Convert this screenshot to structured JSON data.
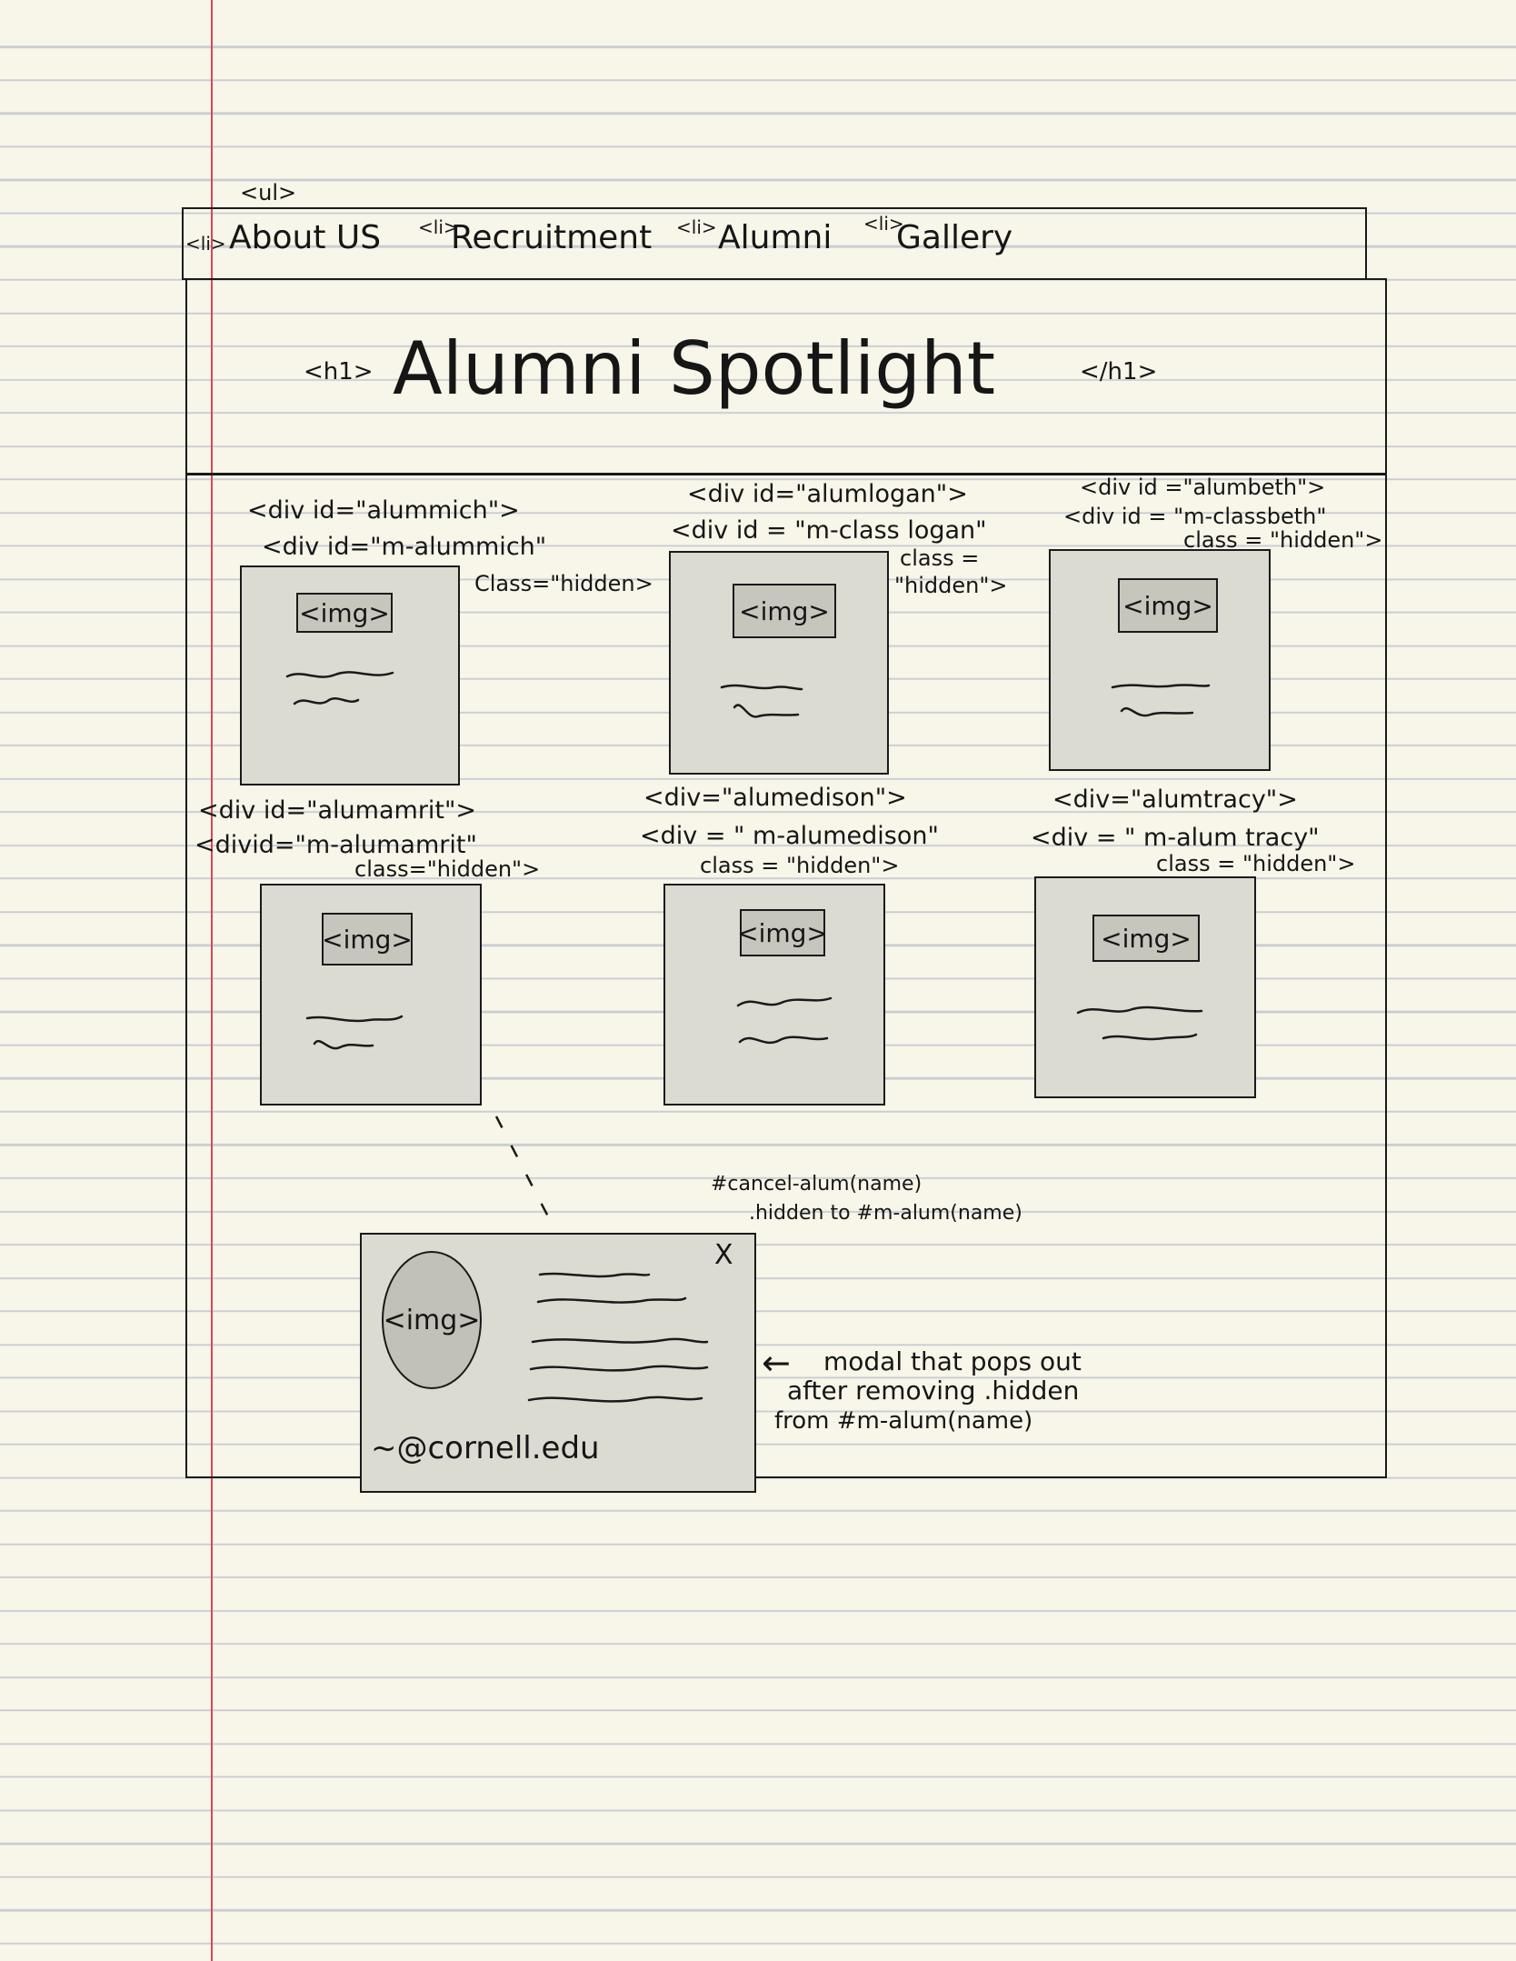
{
  "nav": {
    "ul_tag": "<ul>",
    "items": [
      {
        "tag": "<li>",
        "label": "About US"
      },
      {
        "tag": "<li>",
        "label": "Recruitment"
      },
      {
        "tag": "<li>",
        "label": "Alumni"
      },
      {
        "tag": "<li>",
        "label": "Gallery"
      }
    ]
  },
  "header": {
    "open_tag": "<h1>",
    "title": "Alumni Spotlight",
    "close_tag": "</h1>"
  },
  "cards": [
    {
      "line1": "<div id=\"alummich\">",
      "line2": "<div id=\"m-alummich\"",
      "line3": "Class=\"hidden>",
      "img": "<img>"
    },
    {
      "line1": "<div id=\"alumlogan\">",
      "line2": "<div id = \"m-class logan\"",
      "line3a": "class =",
      "line3": "\"hidden\">",
      "img": "<img>"
    },
    {
      "line1": "<div id =\"alumbeth\">",
      "line2": "<div id = \"m-classbeth\"",
      "line3": "class = \"hidden\">",
      "img": "<img>"
    },
    {
      "line1": "<div id=\"alumamrit\">",
      "line2": "<divid=\"m-alumamrit\"",
      "line3": "class=\"hidden\">",
      "img": "<img>"
    },
    {
      "line1": "<div=\"alumedison\">",
      "line2": "<div = \" m-alumedison\"",
      "line3": "class = \"hidden\">",
      "img": "<img>"
    },
    {
      "line1": "<div=\"alumtracy\">",
      "line2": "<div = \" m-alum tracy\"",
      "line3": "class = \"hidden\">",
      "img": "<img>"
    }
  ],
  "modal": {
    "close_glyph": "X",
    "img": "<img>",
    "email": "~@cornell.edu",
    "cancel_note_1": "#cancel-alum(name)",
    "cancel_note_2": ".hidden to #m-alum(name)",
    "arrow_glyph": "←",
    "desc_1": "modal that pops out",
    "desc_2": "after removing .hidden",
    "desc_3": "from #m-alum(name)"
  }
}
